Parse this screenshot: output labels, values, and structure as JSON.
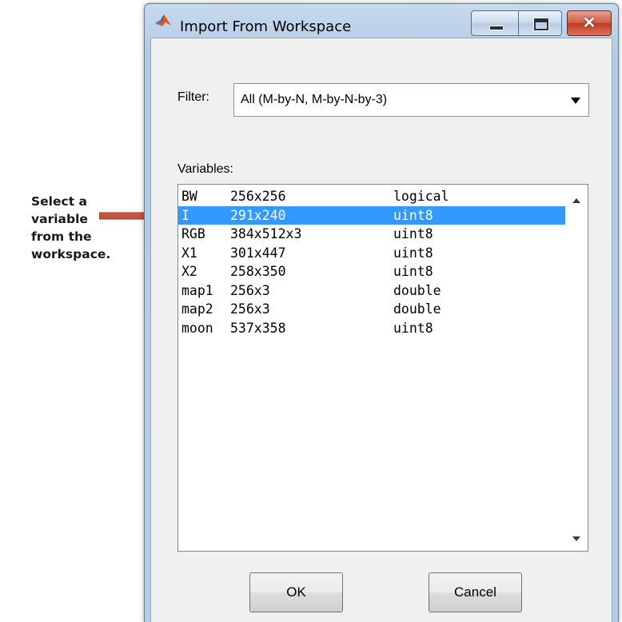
{
  "annotation": {
    "lines": [
      "Select a",
      "variable",
      "from the",
      "workspace."
    ],
    "arrow_color": "#c0504d"
  },
  "window": {
    "title": "Import From Workspace",
    "icon": "matlab-icon",
    "caption_buttons": [
      "minimize-icon",
      "maximize-icon",
      "close-icon"
    ]
  },
  "filter": {
    "label": "Filter:",
    "value": "All (M-by-N, M-by-N-by-3)"
  },
  "variables": {
    "label": "Variables:",
    "selected_index": 1,
    "selection_color": "#3399ff",
    "items": [
      {
        "name": "BW",
        "size": "256x256",
        "class": "logical"
      },
      {
        "name": "I",
        "size": "291x240",
        "class": "uint8"
      },
      {
        "name": "RGB",
        "size": "384x512x3",
        "class": "uint8"
      },
      {
        "name": "X1",
        "size": "301x447",
        "class": "uint8"
      },
      {
        "name": "X2",
        "size": "258x350",
        "class": "uint8"
      },
      {
        "name": "map1",
        "size": "256x3",
        "class": "double"
      },
      {
        "name": "map2",
        "size": "256x3",
        "class": "double"
      },
      {
        "name": "moon",
        "size": "537x358",
        "class": "uint8"
      }
    ]
  },
  "buttons": {
    "ok": "OK",
    "cancel": "Cancel"
  }
}
